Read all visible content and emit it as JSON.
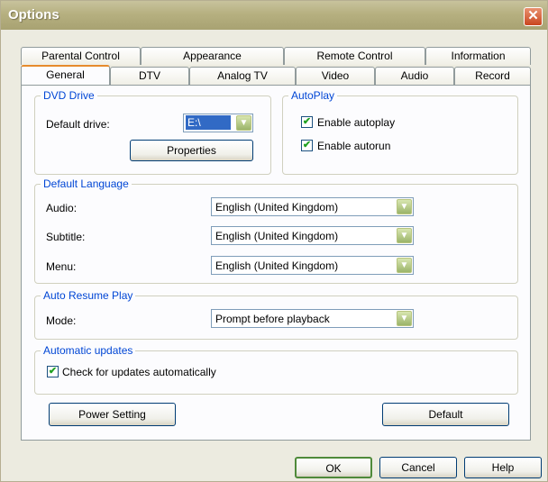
{
  "window": {
    "title": "Options",
    "close_glyph": "✕"
  },
  "tabs_row_back": [
    "Parental Control",
    "Appearance",
    "Remote Control",
    "Information"
  ],
  "tabs_row_front": [
    "General",
    "DTV",
    "Analog TV",
    "Video",
    "Audio",
    "Record"
  ],
  "active_tab": "General",
  "dvd_drive": {
    "group_title": "DVD Drive",
    "default_drive_label": "Default drive:",
    "default_drive_value": "E:\\",
    "properties_button": "Properties"
  },
  "autoplay": {
    "group_title": "AutoPlay",
    "enable_autoplay": {
      "label": "Enable autoplay",
      "checked": true
    },
    "enable_autorun": {
      "label": "Enable autorun",
      "checked": true
    }
  },
  "default_language": {
    "group_title": "Default Language",
    "audio": {
      "label": "Audio:",
      "value": "English (United Kingdom)"
    },
    "subtitle": {
      "label": "Subtitle:",
      "value": "English (United Kingdom)"
    },
    "menu": {
      "label": "Menu:",
      "value": "English (United Kingdom)"
    }
  },
  "auto_resume": {
    "group_title": "Auto Resume Play",
    "mode": {
      "label": "Mode:",
      "value": "Prompt before playback"
    }
  },
  "updates": {
    "group_title": "Automatic updates",
    "check": {
      "label": "Check for updates automatically",
      "checked": true
    }
  },
  "buttons": {
    "power_setting": "Power Setting",
    "default": "Default",
    "ok": "OK",
    "cancel": "Cancel",
    "help": "Help"
  },
  "icons": {
    "check": "✔",
    "dropdown": "▼"
  }
}
